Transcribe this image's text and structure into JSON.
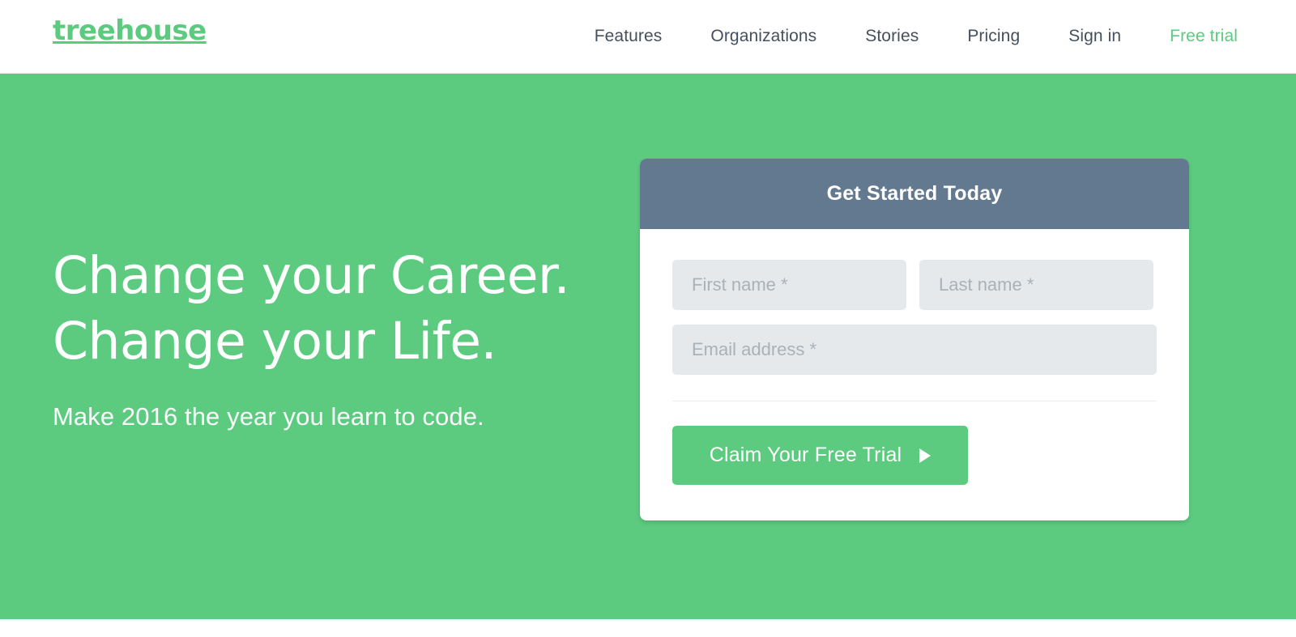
{
  "brand": {
    "name": "treehouse",
    "color": "#5ccb80"
  },
  "header": {
    "nav": [
      {
        "label": "Features",
        "accent": false
      },
      {
        "label": "Organizations",
        "accent": false
      },
      {
        "label": "Stories",
        "accent": false
      },
      {
        "label": "Pricing",
        "accent": false
      },
      {
        "label": "Sign in",
        "accent": false
      },
      {
        "label": "Free trial",
        "accent": true
      }
    ]
  },
  "hero": {
    "background_color": "#5ccb80",
    "title_line1": "Change your Career.",
    "title_line2": "Change your Life.",
    "subtitle": "Make 2016 the year you learn to code."
  },
  "signup_card": {
    "header_title": "Get Started Today",
    "header_color": "#63798f",
    "fields": [
      {
        "name": "first-name",
        "placeholder": "First name *",
        "value": ""
      },
      {
        "name": "last-name",
        "placeholder": "Last name *",
        "value": ""
      },
      {
        "name": "email-address",
        "placeholder": "Email address *",
        "value": ""
      }
    ],
    "cta": {
      "label": "Claim Your Free Trial",
      "icon": "play-triangle-icon",
      "color": "#5ccb80"
    }
  }
}
